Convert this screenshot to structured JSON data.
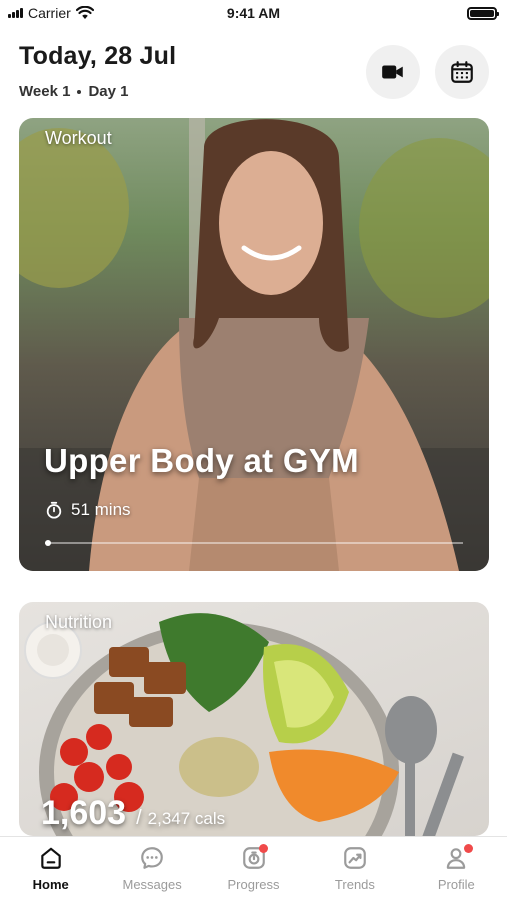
{
  "status_bar": {
    "carrier": "Carrier",
    "time": "9:41 AM"
  },
  "header": {
    "title": "Today, 28 Jul",
    "week": "Week 1",
    "day": "Day 1",
    "icons": [
      "video-camera-icon",
      "calendar-icon"
    ]
  },
  "workout_card": {
    "tag": "Workout",
    "title": "Upper Body at GYM",
    "duration": "51 mins",
    "image": "woman-smiling-outdoors-photo"
  },
  "nutrition_card": {
    "tag": "Nutrition",
    "calories": "1,603",
    "separator": "/",
    "target": "2,347 cals",
    "image": "salad-bowl-photo"
  },
  "tabs": [
    {
      "label": "Home",
      "icon": "home-icon",
      "active": true,
      "badge": false
    },
    {
      "label": "Messages",
      "icon": "chat-icon",
      "active": false,
      "badge": false
    },
    {
      "label": "Progress",
      "icon": "progress-icon",
      "active": false,
      "badge": true
    },
    {
      "label": "Trends",
      "icon": "trends-icon",
      "active": false,
      "badge": false
    },
    {
      "label": "Profile",
      "icon": "profile-icon",
      "active": false,
      "badge": true
    }
  ],
  "colors": {
    "badge": "#f04a4a",
    "active_tab": "#111111",
    "inactive_tab": "#9b9b9b"
  }
}
